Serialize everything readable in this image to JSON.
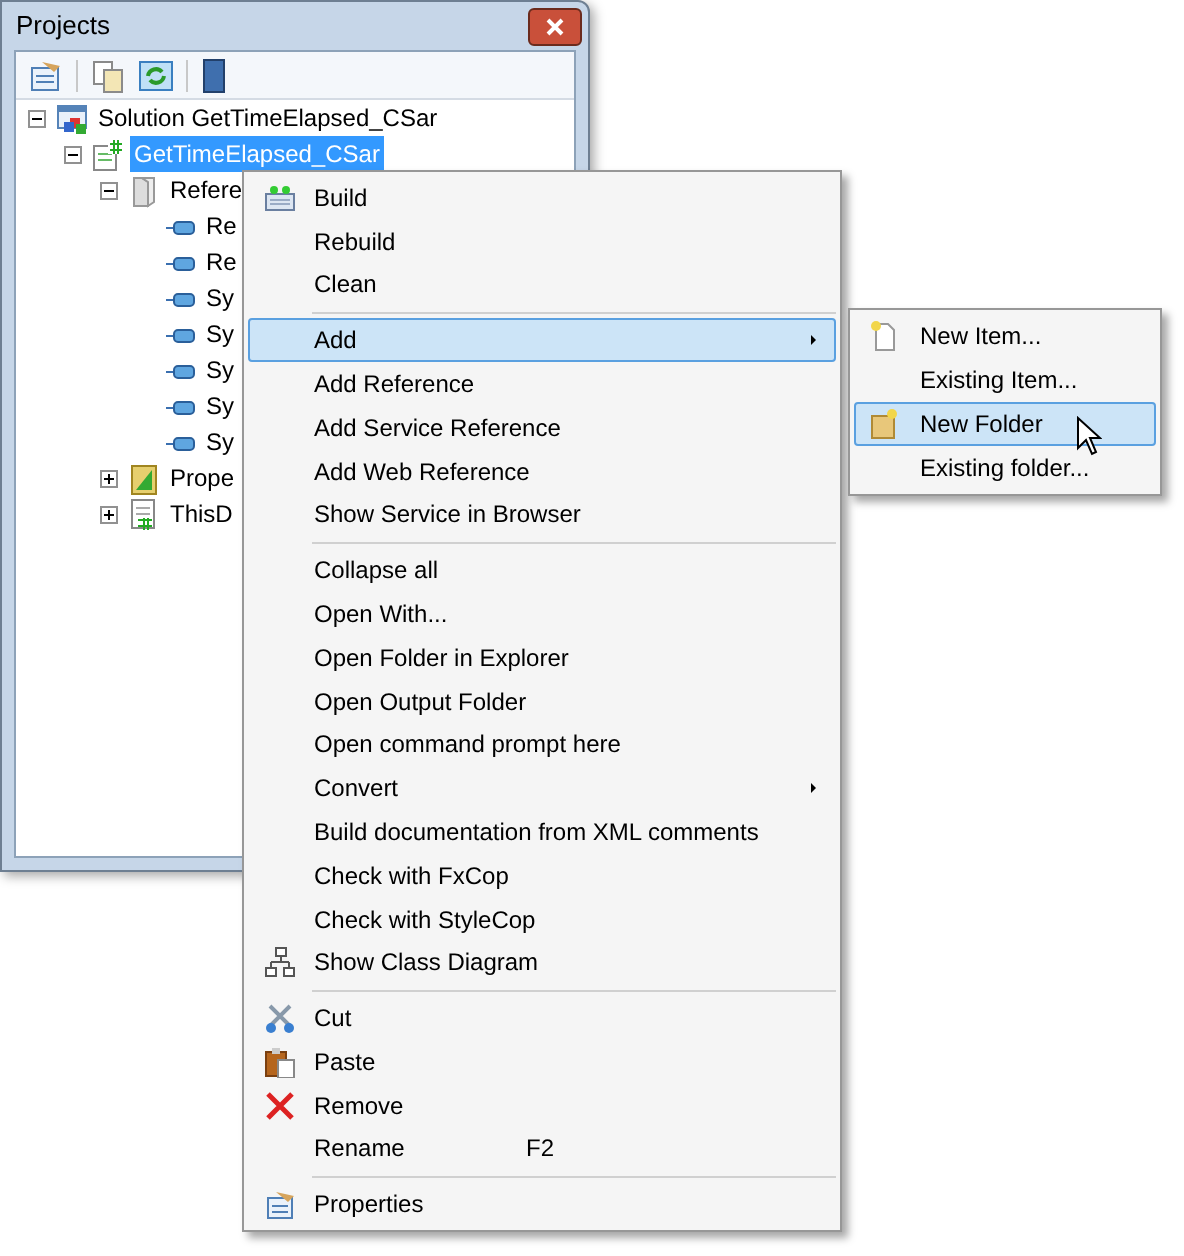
{
  "window": {
    "title": "Projects"
  },
  "tree": [
    {
      "label": "Solution GetTimeElapsed_CSar",
      "kind": "solution",
      "expanded": true,
      "selected": false,
      "children": [
        {
          "label": "GetTimeElapsed_CSar",
          "kind": "project",
          "expanded": true,
          "selected": true,
          "children": [
            {
              "label": "Refere",
              "kind": "references",
              "expanded": true,
              "selected": false,
              "children": [
                {
                  "label": "Re",
                  "kind": "reference",
                  "selected": false
                },
                {
                  "label": "Re",
                  "kind": "reference",
                  "selected": false
                },
                {
                  "label": "Sy",
                  "kind": "reference",
                  "selected": false
                },
                {
                  "label": "Sy",
                  "kind": "reference",
                  "selected": false
                },
                {
                  "label": "Sy",
                  "kind": "reference",
                  "selected": false
                },
                {
                  "label": "Sy",
                  "kind": "reference",
                  "selected": false
                },
                {
                  "label": "Sy",
                  "kind": "reference",
                  "selected": false
                }
              ]
            },
            {
              "label": "Prope",
              "kind": "properties",
              "expanded": false,
              "selected": false
            },
            {
              "label": "ThisD",
              "kind": "file",
              "expanded": false,
              "selected": false
            }
          ]
        }
      ]
    }
  ],
  "context_menu": [
    {
      "kind": "item",
      "label": "Build",
      "selected": false,
      "has_submenu": false
    },
    {
      "kind": "item",
      "label": "Rebuild",
      "selected": false,
      "has_submenu": false
    },
    {
      "kind": "item",
      "label": "Clean",
      "selected": false,
      "has_submenu": false
    },
    {
      "kind": "separator"
    },
    {
      "kind": "item",
      "label": "Add",
      "selected": true,
      "has_submenu": true
    },
    {
      "kind": "item",
      "label": "Add Reference",
      "selected": false,
      "has_submenu": false
    },
    {
      "kind": "item",
      "label": "Add Service Reference",
      "selected": false,
      "has_submenu": false
    },
    {
      "kind": "item",
      "label": "Add Web Reference",
      "selected": false,
      "has_submenu": false
    },
    {
      "kind": "item",
      "label": "Show Service in Browser",
      "selected": false,
      "has_submenu": false
    },
    {
      "kind": "separator"
    },
    {
      "kind": "item",
      "label": "Collapse all",
      "selected": false,
      "has_submenu": false
    },
    {
      "kind": "item",
      "label": "Open With...",
      "selected": false,
      "has_submenu": false
    },
    {
      "kind": "item",
      "label": "Open Folder in Explorer",
      "selected": false,
      "has_submenu": false
    },
    {
      "kind": "item",
      "label": "Open Output Folder",
      "selected": false,
      "has_submenu": false
    },
    {
      "kind": "item",
      "label": "Open command prompt here",
      "selected": false,
      "has_submenu": false
    },
    {
      "kind": "item",
      "label": "Convert",
      "selected": false,
      "has_submenu": true
    },
    {
      "kind": "item",
      "label": "Build documentation from XML comments",
      "selected": false,
      "has_submenu": false
    },
    {
      "kind": "item",
      "label": "Check with FxCop",
      "selected": false,
      "has_submenu": false
    },
    {
      "kind": "item",
      "label": "Check with StyleCop",
      "selected": false,
      "has_submenu": false
    },
    {
      "kind": "item",
      "label": "Show Class Diagram",
      "selected": false,
      "has_submenu": false
    },
    {
      "kind": "separator"
    },
    {
      "kind": "item",
      "label": "Cut",
      "selected": false,
      "has_submenu": false
    },
    {
      "kind": "item",
      "label": "Paste",
      "selected": false,
      "has_submenu": false
    },
    {
      "kind": "item",
      "label": "Remove",
      "selected": false,
      "has_submenu": false
    },
    {
      "kind": "item",
      "label": "Rename",
      "selected": false,
      "has_submenu": false,
      "shortcut": "F2"
    },
    {
      "kind": "separator"
    },
    {
      "kind": "item",
      "label": "Properties",
      "selected": false,
      "has_submenu": false
    }
  ],
  "submenu": [
    {
      "label": "New Item...",
      "selected": false
    },
    {
      "label": "Existing Item...",
      "selected": false
    },
    {
      "label": "New Folder",
      "selected": true
    },
    {
      "label": "Existing folder...",
      "selected": false
    }
  ]
}
